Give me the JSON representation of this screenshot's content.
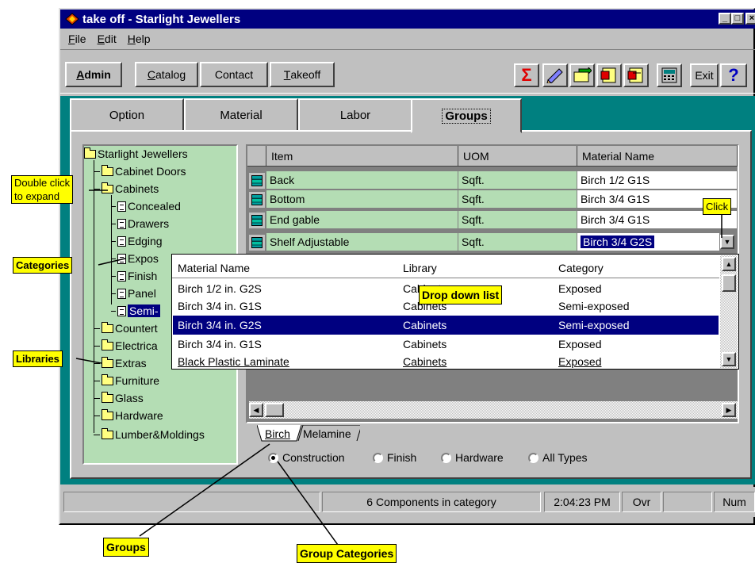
{
  "window": {
    "title": "take off - Starlight Jewellers"
  },
  "menu": [
    {
      "label": "File",
      "u": "F",
      "rest": "ile"
    },
    {
      "label": "Edit",
      "u": "E",
      "rest": "dit"
    },
    {
      "label": "Help",
      "u": "H",
      "rest": "elp"
    }
  ],
  "toolbar": {
    "buttons": [
      {
        "label": "Admin",
        "u": "A",
        "rest": "dmin"
      },
      {
        "label": "Catalog",
        "u": "C",
        "rest": "atalog"
      },
      {
        "label": "Contact",
        "u": "",
        "rest": "Contact"
      },
      {
        "label": "Takeoff",
        "u": "T",
        "rest": "akeoff"
      }
    ],
    "exit_label": "Exit",
    "help_label": "?"
  },
  "tabs": [
    "Option",
    "Material",
    "Labor",
    "Groups"
  ],
  "active_tab": "Groups",
  "tree": {
    "root": "Starlight Jewellers",
    "items": [
      "Cabinet Doors",
      "Cabinets",
      "Concealed",
      "Drawers",
      "Edging",
      "Expos",
      "Finish",
      "Panel",
      "Semi-",
      "Countert",
      "Electrica",
      "Extras",
      "Furniture",
      "Glass",
      "Hardware",
      "Lumber&Moldings"
    ]
  },
  "grid": {
    "headers": [
      "Item",
      "UOM",
      "Material Name"
    ],
    "rows": [
      {
        "item": "Back",
        "uom": "Sqft.",
        "material": "Birch 1/2 G1S"
      },
      {
        "item": "Bottom",
        "uom": "Sqft.",
        "material": "Birch 3/4 G1S"
      },
      {
        "item": "End gable",
        "uom": "Sqft.",
        "material": "Birch 3/4 G1S"
      },
      {
        "item": "Shelf Adjustable",
        "uom": "Sqft.",
        "material": "Birch 3/4 G2S"
      }
    ]
  },
  "dropdown": {
    "headers": [
      "Material Name",
      "Library",
      "Category"
    ],
    "rows": [
      {
        "name": "Birch 1/2 in. G2S",
        "library": "Cabinets",
        "category": "Exposed"
      },
      {
        "name": "Birch 3/4 in.  G1S",
        "library": "Cabinets",
        "category": "Semi-exposed"
      },
      {
        "name": "Birch 3/4 in.  G2S",
        "library": "Cabinets",
        "category": "Semi-exposed"
      },
      {
        "name": "Birch 3/4 in. G1S",
        "library": "Cabinets",
        "category": "Exposed"
      },
      {
        "name": "Black Plastic Laminate",
        "library": "Cabinets",
        "category": "Exposed"
      }
    ],
    "selected_index": 2
  },
  "group_tabs": [
    "Birch",
    "Melamine"
  ],
  "radios": [
    {
      "label": "Construction",
      "checked": true
    },
    {
      "label": "Finish",
      "checked": false
    },
    {
      "label": "Hardware",
      "checked": false
    },
    {
      "label": "All Types",
      "checked": false
    }
  ],
  "status": {
    "message": "6 Components in category",
    "time": "2:04:23 PM",
    "mode": "Ovr",
    "num": "Num"
  },
  "callouts": {
    "double_click": "Double click\nto expand",
    "categories": "Categories",
    "libraries": "Libraries",
    "click": "Click",
    "drop_down": "Drop down list",
    "groups": "Groups",
    "group_categories": "Group Categories"
  }
}
